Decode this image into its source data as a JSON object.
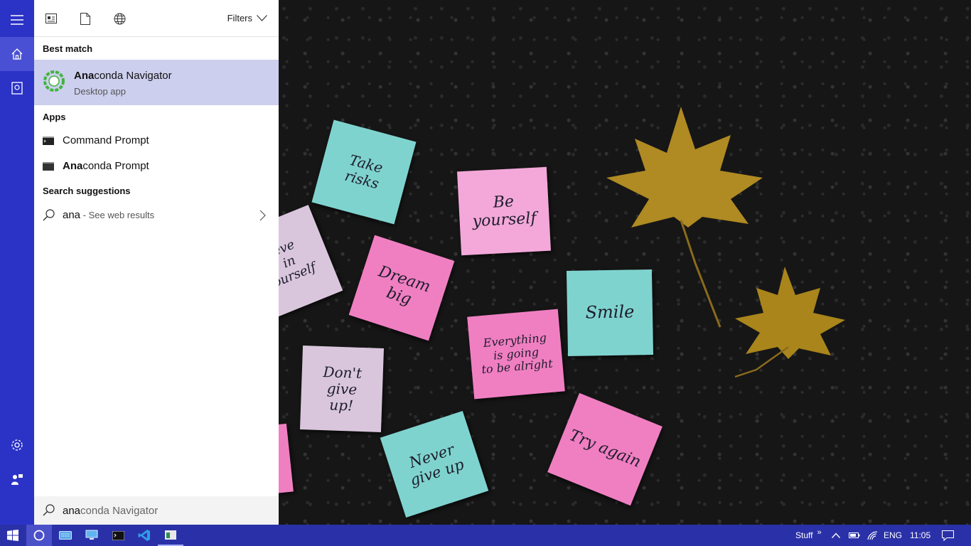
{
  "toolbar": {
    "filters_label": "Filters"
  },
  "best_match": {
    "heading": "Best match",
    "name_highlight": "Ana",
    "name_rest": "conda Navigator",
    "subtitle": "Desktop app"
  },
  "apps": {
    "heading": "Apps",
    "items": [
      {
        "highlight": "",
        "rest": "Command Prompt"
      },
      {
        "highlight": "Ana",
        "rest": "conda Prompt"
      }
    ]
  },
  "suggestions": {
    "heading": "Search suggestions",
    "items": [
      {
        "query": "ana",
        "hint": " - See web results"
      }
    ]
  },
  "search": {
    "typed": "ana",
    "autocomplete": "conda Navigator",
    "value": "anaconda Navigator"
  },
  "taskbar": {
    "tray_label": "Stuff",
    "tray_chevron": "»",
    "language": "ENG",
    "time": "11:05"
  },
  "wallpaper": {
    "notes": [
      {
        "text": "Take\nrisks"
      },
      {
        "text": "Be\nyourself"
      },
      {
        "text": "eve\nin\nourself"
      },
      {
        "text": "Dream\nbig"
      },
      {
        "text": "Smile"
      },
      {
        "text": "Everything\nis going\nto be alright"
      },
      {
        "text": "Don't\ngive\nup!"
      },
      {
        "text": "Never\ngive up"
      },
      {
        "text": "Try again"
      }
    ]
  },
  "colors": {
    "rail": "#2b32c6",
    "taskbar": "#2a31a8",
    "selection": "#cdcfee",
    "accent": "#3fb53f"
  }
}
